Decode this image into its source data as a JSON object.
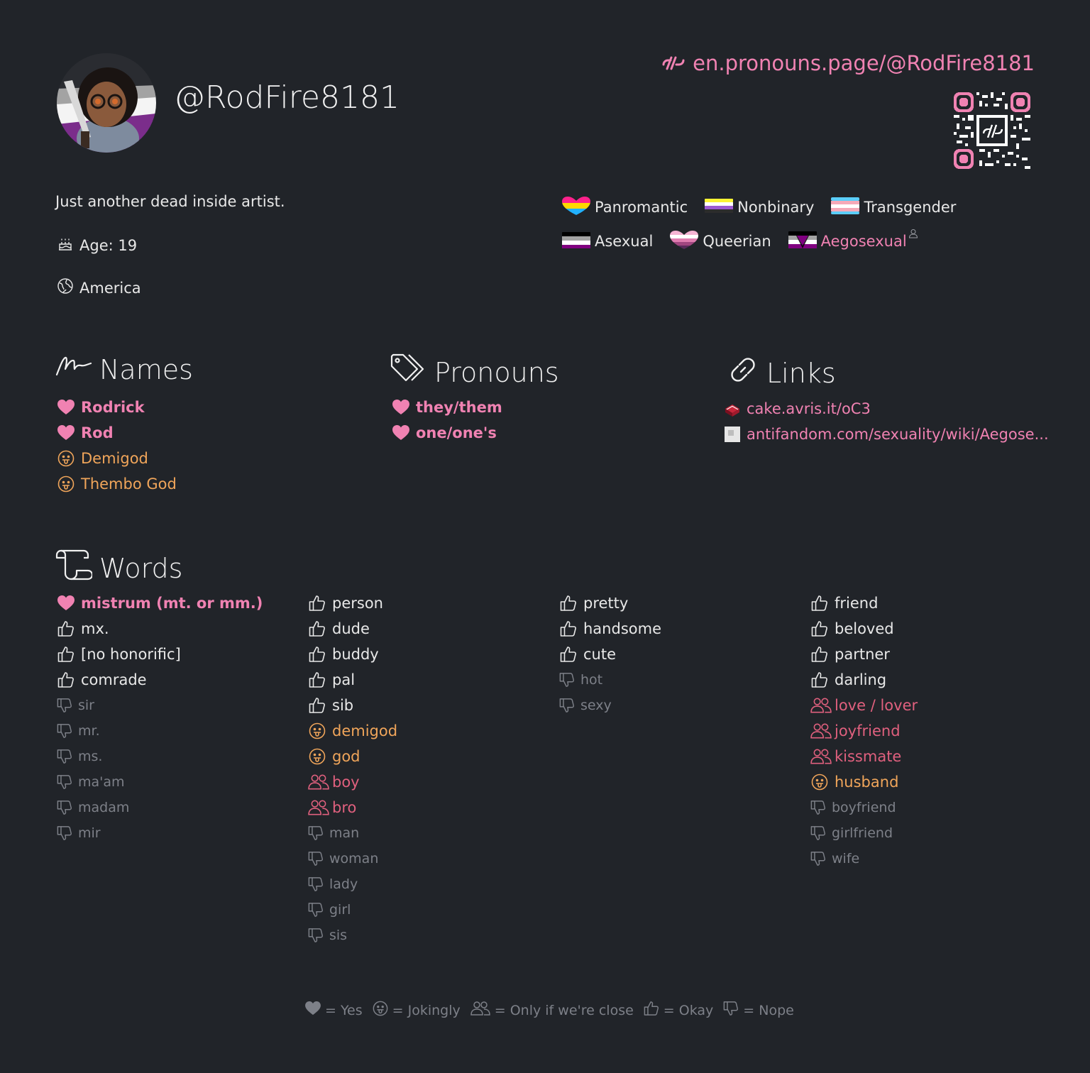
{
  "profile": {
    "username": "@RodFire8181",
    "url": "en.pronouns.page/@RodFire8181",
    "bio": "Just another dead inside artist.",
    "age": "Age: 19",
    "location": "America"
  },
  "flags": [
    {
      "label": "Panromantic",
      "icon": "panromantic-flag"
    },
    {
      "label": "Nonbinary",
      "icon": "nonbinary-flag"
    },
    {
      "label": "Transgender",
      "icon": "transgender-flag"
    },
    {
      "label": "Asexual",
      "icon": "asexual-flag"
    },
    {
      "label": "Queerian",
      "icon": "queerian-flag"
    },
    {
      "label": "Aegosexual",
      "icon": "aegosexual-flag"
    }
  ],
  "sections": {
    "names_title": "Names",
    "pronouns_title": "Pronouns",
    "links_title": "Links",
    "words_title": "Words"
  },
  "names": [
    "Rodrick",
    "Rod",
    "Demigod",
    "Thembo God"
  ],
  "pronouns": [
    "they/them",
    "one/one's"
  ],
  "links": [
    "cake.avris.it/oC3",
    "antifandom.com/sexuality/wiki/Aegose..."
  ],
  "words": {
    "col1": [
      "mistrum (mt. or mm.)",
      "mx.",
      "[no honorific]",
      "comrade",
      "sir",
      "mr.",
      "ms.",
      "ma'am",
      "madam",
      "mir"
    ],
    "col2": [
      "person",
      "dude",
      "buddy",
      "pal",
      "sib",
      "demigod",
      "god",
      "boy",
      "bro",
      "man",
      "woman",
      "lady",
      "girl",
      "sis"
    ],
    "col3": [
      "pretty",
      "handsome",
      "cute",
      "hot",
      "sexy"
    ],
    "col4": [
      "friend",
      "beloved",
      "partner",
      "darling",
      "love / lover",
      "joyfriend",
      "kissmate",
      "husband",
      "boyfriend",
      "girlfriend",
      "wife"
    ]
  },
  "legend": {
    "yes": "= Yes",
    "jokingly": "= Jokingly",
    "close": "= Only if we're close",
    "okay": "= Okay",
    "nope": "= Nope"
  },
  "colors": {
    "background": "#212429",
    "accent_pink": "#f082b2",
    "jokingly": "#f0a55a",
    "close": "#e0607e",
    "nope": "#7d8088"
  }
}
